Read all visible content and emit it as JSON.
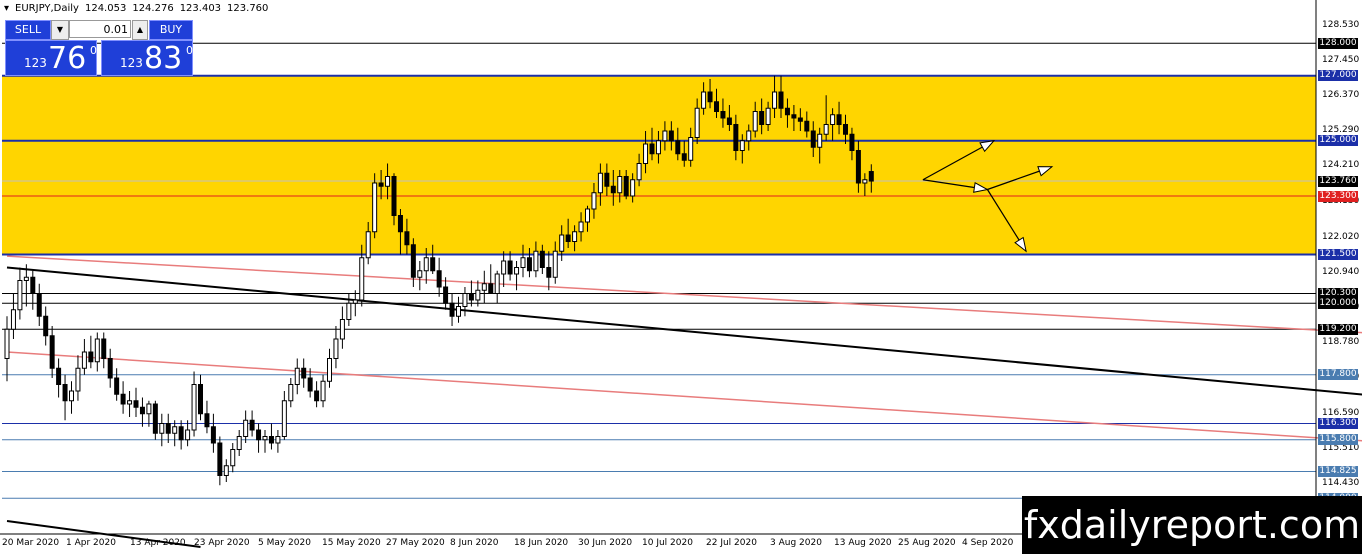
{
  "header": {
    "symbol": "EURJPY,Daily",
    "open": "124.053",
    "high": "124.276",
    "low": "123.403",
    "close": "123.760"
  },
  "trade_panel": {
    "sell_label": "SELL",
    "buy_label": "BUY",
    "lot": "0.01",
    "sell_small": "123",
    "sell_big": "76",
    "sell_sup": "0",
    "buy_small": "123",
    "buy_big": "83",
    "buy_sup": "0"
  },
  "price_scale": [
    "128.530",
    "127.450",
    "126.370",
    "125.290",
    "124.210",
    "123.130",
    "122.020",
    "120.940",
    "119.860",
    "118.780",
    "117.700",
    "116.590",
    "115.510",
    "114.430",
    "113.350"
  ],
  "level_labels": [
    {
      "text": "128.000",
      "bg": "#000000"
    },
    {
      "text": "127.000",
      "bg": "#1b2fa8"
    },
    {
      "text": "125.000",
      "bg": "#1b2fa8"
    },
    {
      "text": "123.760",
      "bg": "#000000"
    },
    {
      "text": "123.300",
      "bg": "#e02020"
    },
    {
      "text": "121.500",
      "bg": "#1b2fa8"
    },
    {
      "text": "120.300",
      "bg": "#000000"
    },
    {
      "text": "120.000",
      "bg": "#000000"
    },
    {
      "text": "119.200",
      "bg": "#000000"
    },
    {
      "text": "117.800",
      "bg": "#4a7cb0"
    },
    {
      "text": "116.300",
      "bg": "#1b2fa8"
    },
    {
      "text": "115.800",
      "bg": "#4a7cb0"
    },
    {
      "text": "114.825",
      "bg": "#4a7cb0"
    },
    {
      "text": "114.000",
      "bg": "#4a7cb0"
    }
  ],
  "dates": [
    "20 Mar 2020",
    "1 Apr 2020",
    "13 Apr 2020",
    "23 Apr 2020",
    "5 May 2020",
    "15 May 2020",
    "27 May 2020",
    "8 Jun 2020",
    "18 Jun 2020",
    "30 Jun 2020",
    "10 Jul 2020",
    "22 Jul 2020",
    "3 Aug 2020",
    "13 Aug 2020",
    "25 Aug 2020",
    "4 Sep 2020"
  ],
  "watermark": "fxdailyreport.com",
  "colors": {
    "zone": "#ffd500",
    "bull": "#ffffff",
    "bear": "#000000",
    "blue_line": "#1b2fa8",
    "red_line": "#e02020",
    "trend_red": "#e87c7c"
  },
  "chart_data": {
    "type": "candlestick",
    "symbol": "EURJPY",
    "timeframe": "Daily",
    "y_range": [
      112.9,
      128.9
    ],
    "zone": [
      121.5,
      127.0
    ],
    "horizontal_levels": [
      128.0,
      127.0,
      125.0,
      123.76,
      123.3,
      121.5,
      120.3,
      120.0,
      119.2,
      117.8,
      116.3,
      115.8,
      114.825,
      114.0
    ],
    "candles": [
      {
        "o": 118.3,
        "h": 119.6,
        "l": 117.6,
        "c": 119.2
      },
      {
        "o": 119.2,
        "h": 120.3,
        "l": 118.9,
        "c": 119.8
      },
      {
        "o": 119.8,
        "h": 121.1,
        "l": 119.5,
        "c": 120.7
      },
      {
        "o": 120.7,
        "h": 121.2,
        "l": 119.9,
        "c": 120.8
      },
      {
        "o": 120.8,
        "h": 121.0,
        "l": 119.8,
        "c": 120.3
      },
      {
        "o": 120.3,
        "h": 120.6,
        "l": 119.3,
        "c": 119.6
      },
      {
        "o": 119.6,
        "h": 119.9,
        "l": 118.7,
        "c": 119.0
      },
      {
        "o": 119.0,
        "h": 119.3,
        "l": 117.7,
        "c": 118.0
      },
      {
        "o": 118.0,
        "h": 118.3,
        "l": 117.1,
        "c": 117.5
      },
      {
        "o": 117.5,
        "h": 117.8,
        "l": 116.4,
        "c": 117.0
      },
      {
        "o": 117.0,
        "h": 117.6,
        "l": 116.6,
        "c": 117.3
      },
      {
        "o": 117.3,
        "h": 118.4,
        "l": 117.0,
        "c": 118.0
      },
      {
        "o": 118.0,
        "h": 118.9,
        "l": 117.8,
        "c": 118.5
      },
      {
        "o": 118.5,
        "h": 119.0,
        "l": 118.0,
        "c": 118.2
      },
      {
        "o": 118.2,
        "h": 119.1,
        "l": 117.9,
        "c": 118.9
      },
      {
        "o": 118.9,
        "h": 119.1,
        "l": 118.0,
        "c": 118.3
      },
      {
        "o": 118.3,
        "h": 118.6,
        "l": 117.4,
        "c": 117.7
      },
      {
        "o": 117.7,
        "h": 118.0,
        "l": 117.0,
        "c": 117.2
      },
      {
        "o": 117.2,
        "h": 117.6,
        "l": 116.6,
        "c": 116.9
      },
      {
        "o": 116.9,
        "h": 117.3,
        "l": 116.5,
        "c": 117.0
      },
      {
        "o": 117.0,
        "h": 117.4,
        "l": 116.5,
        "c": 116.8
      },
      {
        "o": 116.8,
        "h": 117.1,
        "l": 116.2,
        "c": 116.6
      },
      {
        "o": 116.6,
        "h": 117.0,
        "l": 116.2,
        "c": 116.9
      },
      {
        "o": 116.9,
        "h": 117.0,
        "l": 115.8,
        "c": 116.0
      },
      {
        "o": 116.0,
        "h": 116.6,
        "l": 115.6,
        "c": 116.3
      },
      {
        "o": 116.3,
        "h": 116.6,
        "l": 115.7,
        "c": 116.0
      },
      {
        "o": 116.0,
        "h": 116.4,
        "l": 115.6,
        "c": 116.2
      },
      {
        "o": 116.2,
        "h": 116.4,
        "l": 115.5,
        "c": 115.8
      },
      {
        "o": 115.8,
        "h": 116.4,
        "l": 115.6,
        "c": 116.1
      },
      {
        "o": 116.1,
        "h": 117.9,
        "l": 115.9,
        "c": 117.5
      },
      {
        "o": 117.5,
        "h": 117.8,
        "l": 116.4,
        "c": 116.6
      },
      {
        "o": 116.6,
        "h": 117.0,
        "l": 116.0,
        "c": 116.2
      },
      {
        "o": 116.2,
        "h": 116.6,
        "l": 115.4,
        "c": 115.7
      },
      {
        "o": 115.7,
        "h": 115.9,
        "l": 114.4,
        "c": 114.7
      },
      {
        "o": 114.7,
        "h": 115.2,
        "l": 114.5,
        "c": 115.0
      },
      {
        "o": 115.0,
        "h": 115.7,
        "l": 114.8,
        "c": 115.5
      },
      {
        "o": 115.5,
        "h": 116.1,
        "l": 115.3,
        "c": 115.9
      },
      {
        "o": 115.9,
        "h": 116.7,
        "l": 115.7,
        "c": 116.4
      },
      {
        "o": 116.4,
        "h": 116.7,
        "l": 115.9,
        "c": 116.1
      },
      {
        "o": 116.1,
        "h": 116.3,
        "l": 115.4,
        "c": 115.8
      },
      {
        "o": 115.8,
        "h": 116.1,
        "l": 115.4,
        "c": 115.9
      },
      {
        "o": 115.9,
        "h": 116.3,
        "l": 115.5,
        "c": 115.7
      },
      {
        "o": 115.7,
        "h": 116.1,
        "l": 115.4,
        "c": 115.9
      },
      {
        "o": 115.9,
        "h": 117.3,
        "l": 115.8,
        "c": 117.0
      },
      {
        "o": 117.0,
        "h": 117.7,
        "l": 116.8,
        "c": 117.5
      },
      {
        "o": 117.5,
        "h": 118.3,
        "l": 117.2,
        "c": 118.0
      },
      {
        "o": 118.0,
        "h": 118.3,
        "l": 117.4,
        "c": 117.7
      },
      {
        "o": 117.7,
        "h": 118.0,
        "l": 117.1,
        "c": 117.3
      },
      {
        "o": 117.3,
        "h": 117.6,
        "l": 116.8,
        "c": 117.0
      },
      {
        "o": 117.0,
        "h": 117.8,
        "l": 116.8,
        "c": 117.6
      },
      {
        "o": 117.6,
        "h": 118.6,
        "l": 117.4,
        "c": 118.3
      },
      {
        "o": 118.3,
        "h": 119.3,
        "l": 118.0,
        "c": 118.9
      },
      {
        "o": 118.9,
        "h": 119.9,
        "l": 118.6,
        "c": 119.5
      },
      {
        "o": 119.5,
        "h": 120.3,
        "l": 119.3,
        "c": 120.0
      },
      {
        "o": 120.0,
        "h": 120.4,
        "l": 119.6,
        "c": 120.1
      },
      {
        "o": 120.1,
        "h": 121.8,
        "l": 119.9,
        "c": 121.4
      },
      {
        "o": 121.4,
        "h": 122.5,
        "l": 121.2,
        "c": 122.2
      },
      {
        "o": 122.2,
        "h": 124.0,
        "l": 122.0,
        "c": 123.7
      },
      {
        "o": 123.7,
        "h": 124.1,
        "l": 123.2,
        "c": 123.6
      },
      {
        "o": 123.6,
        "h": 124.3,
        "l": 123.2,
        "c": 123.9
      },
      {
        "o": 123.9,
        "h": 124.0,
        "l": 122.4,
        "c": 122.7
      },
      {
        "o": 122.7,
        "h": 122.9,
        "l": 121.5,
        "c": 122.2
      },
      {
        "o": 122.2,
        "h": 122.6,
        "l": 121.5,
        "c": 121.8
      },
      {
        "o": 121.8,
        "h": 122.0,
        "l": 120.5,
        "c": 120.8
      },
      {
        "o": 120.8,
        "h": 121.3,
        "l": 120.4,
        "c": 121.0
      },
      {
        "o": 121.0,
        "h": 121.7,
        "l": 120.6,
        "c": 121.4
      },
      {
        "o": 121.4,
        "h": 121.8,
        "l": 120.9,
        "c": 121.0
      },
      {
        "o": 121.0,
        "h": 121.4,
        "l": 120.2,
        "c": 120.5
      },
      {
        "o": 120.5,
        "h": 120.8,
        "l": 119.8,
        "c": 120.0
      },
      {
        "o": 120.0,
        "h": 120.3,
        "l": 119.3,
        "c": 119.6
      },
      {
        "o": 119.6,
        "h": 120.2,
        "l": 119.4,
        "c": 119.9
      },
      {
        "o": 119.9,
        "h": 120.5,
        "l": 119.6,
        "c": 120.3
      },
      {
        "o": 120.3,
        "h": 120.7,
        "l": 119.9,
        "c": 120.1
      },
      {
        "o": 120.1,
        "h": 120.7,
        "l": 119.9,
        "c": 120.4
      },
      {
        "o": 120.4,
        "h": 121.0,
        "l": 120.0,
        "c": 120.6
      },
      {
        "o": 120.6,
        "h": 121.2,
        "l": 120.3,
        "c": 120.3
      },
      {
        "o": 120.3,
        "h": 121.0,
        "l": 120.0,
        "c": 120.9
      },
      {
        "o": 120.9,
        "h": 121.6,
        "l": 120.5,
        "c": 121.3
      },
      {
        "o": 121.3,
        "h": 121.6,
        "l": 120.7,
        "c": 120.9
      },
      {
        "o": 120.9,
        "h": 121.3,
        "l": 120.4,
        "c": 121.1
      },
      {
        "o": 121.1,
        "h": 121.8,
        "l": 120.8,
        "c": 121.4
      },
      {
        "o": 121.4,
        "h": 121.7,
        "l": 120.8,
        "c": 121.0
      },
      {
        "o": 121.0,
        "h": 121.9,
        "l": 120.8,
        "c": 121.6
      },
      {
        "o": 121.6,
        "h": 121.8,
        "l": 120.9,
        "c": 121.1
      },
      {
        "o": 121.1,
        "h": 121.6,
        "l": 120.4,
        "c": 120.8
      },
      {
        "o": 120.8,
        "h": 121.9,
        "l": 120.6,
        "c": 121.6
      },
      {
        "o": 121.6,
        "h": 122.4,
        "l": 121.3,
        "c": 122.1
      },
      {
        "o": 122.1,
        "h": 122.6,
        "l": 121.7,
        "c": 121.9
      },
      {
        "o": 121.9,
        "h": 122.4,
        "l": 121.6,
        "c": 122.2
      },
      {
        "o": 122.2,
        "h": 122.8,
        "l": 121.9,
        "c": 122.5
      },
      {
        "o": 122.5,
        "h": 123.0,
        "l": 122.2,
        "c": 122.9
      },
      {
        "o": 122.9,
        "h": 123.7,
        "l": 122.6,
        "c": 123.4
      },
      {
        "o": 123.4,
        "h": 124.3,
        "l": 123.0,
        "c": 124.0
      },
      {
        "o": 124.0,
        "h": 124.3,
        "l": 123.3,
        "c": 123.6
      },
      {
        "o": 123.6,
        "h": 124.1,
        "l": 123.0,
        "c": 123.4
      },
      {
        "o": 123.4,
        "h": 124.1,
        "l": 123.1,
        "c": 123.9
      },
      {
        "o": 123.9,
        "h": 124.1,
        "l": 123.2,
        "c": 123.3
      },
      {
        "o": 123.3,
        "h": 124.0,
        "l": 123.1,
        "c": 123.8
      },
      {
        "o": 123.8,
        "h": 124.6,
        "l": 123.6,
        "c": 124.3
      },
      {
        "o": 124.3,
        "h": 125.3,
        "l": 124.0,
        "c": 124.9
      },
      {
        "o": 124.9,
        "h": 125.4,
        "l": 124.4,
        "c": 124.6
      },
      {
        "o": 124.6,
        "h": 125.3,
        "l": 124.3,
        "c": 125.0
      },
      {
        "o": 125.0,
        "h": 125.6,
        "l": 124.7,
        "c": 125.3
      },
      {
        "o": 125.3,
        "h": 125.6,
        "l": 124.7,
        "c": 125.0
      },
      {
        "o": 125.0,
        "h": 125.4,
        "l": 124.4,
        "c": 124.6
      },
      {
        "o": 124.6,
        "h": 125.0,
        "l": 124.2,
        "c": 124.4
      },
      {
        "o": 124.4,
        "h": 125.4,
        "l": 124.2,
        "c": 125.1
      },
      {
        "o": 125.1,
        "h": 126.3,
        "l": 124.9,
        "c": 126.0
      },
      {
        "o": 126.0,
        "h": 126.8,
        "l": 125.8,
        "c": 126.5
      },
      {
        "o": 126.5,
        "h": 126.9,
        "l": 126.0,
        "c": 126.2
      },
      {
        "o": 126.2,
        "h": 126.6,
        "l": 125.7,
        "c": 125.9
      },
      {
        "o": 125.9,
        "h": 126.3,
        "l": 125.4,
        "c": 125.7
      },
      {
        "o": 125.7,
        "h": 126.1,
        "l": 125.3,
        "c": 125.5
      },
      {
        "o": 125.5,
        "h": 125.8,
        "l": 124.4,
        "c": 124.7
      },
      {
        "o": 124.7,
        "h": 125.2,
        "l": 124.3,
        "c": 125.0
      },
      {
        "o": 125.0,
        "h": 125.5,
        "l": 124.7,
        "c": 125.3
      },
      {
        "o": 125.3,
        "h": 126.2,
        "l": 125.1,
        "c": 125.9
      },
      {
        "o": 125.9,
        "h": 126.3,
        "l": 125.2,
        "c": 125.5
      },
      {
        "o": 125.5,
        "h": 126.2,
        "l": 125.3,
        "c": 126.0
      },
      {
        "o": 126.0,
        "h": 127.0,
        "l": 125.7,
        "c": 126.5
      },
      {
        "o": 126.5,
        "h": 127.0,
        "l": 125.7,
        "c": 126.0
      },
      {
        "o": 126.0,
        "h": 126.3,
        "l": 125.4,
        "c": 125.8
      },
      {
        "o": 125.8,
        "h": 126.1,
        "l": 125.3,
        "c": 125.7
      },
      {
        "o": 125.7,
        "h": 126.0,
        "l": 125.3,
        "c": 125.6
      },
      {
        "o": 125.6,
        "h": 125.9,
        "l": 125.1,
        "c": 125.3
      },
      {
        "o": 125.3,
        "h": 125.6,
        "l": 124.5,
        "c": 124.8
      },
      {
        "o": 124.8,
        "h": 125.4,
        "l": 124.3,
        "c": 125.2
      },
      {
        "o": 125.2,
        "h": 126.4,
        "l": 125.0,
        "c": 125.5
      },
      {
        "o": 125.5,
        "h": 126.0,
        "l": 125.0,
        "c": 125.8
      },
      {
        "o": 125.8,
        "h": 126.2,
        "l": 125.2,
        "c": 125.5
      },
      {
        "o": 125.5,
        "h": 125.8,
        "l": 124.9,
        "c": 125.2
      },
      {
        "o": 125.2,
        "h": 125.4,
        "l": 124.4,
        "c": 124.7
      },
      {
        "o": 124.7,
        "h": 125.0,
        "l": 123.4,
        "c": 123.7
      },
      {
        "o": 123.7,
        "h": 124.0,
        "l": 123.3,
        "c": 123.8
      },
      {
        "o": 124.053,
        "h": 124.276,
        "l": 123.403,
        "c": 123.76
      }
    ],
    "trendlines": [
      {
        "color": "black",
        "p1": {
          "i": 0,
          "price": 121.1
        },
        "p2": {
          "i": 250,
          "price": 116.45
        }
      },
      {
        "color": "red",
        "p1": {
          "i": 0,
          "price": 121.45
        },
        "p2": {
          "i": 250,
          "price": 118.65
        }
      },
      {
        "color": "red",
        "p1": {
          "i": 0,
          "price": 118.5
        },
        "p2": {
          "i": 250,
          "price": 115.25
        }
      },
      {
        "color": "black",
        "p1": {
          "i": 0,
          "price": 113.3
        },
        "p2": {
          "i": 30,
          "price": 112.5
        }
      }
    ],
    "projection_arrows": [
      {
        "from": {
          "i": 142,
          "price": 123.8
        },
        "to": {
          "i": 153,
          "price": 125.0
        }
      },
      {
        "from": {
          "i": 142,
          "price": 123.8
        },
        "to": {
          "i": 152,
          "price": 123.5
        }
      },
      {
        "from": {
          "i": 152,
          "price": 123.5
        },
        "to": {
          "i": 162,
          "price": 124.2
        }
      },
      {
        "from": {
          "i": 152,
          "price": 123.5
        },
        "to": {
          "i": 158,
          "price": 121.6
        }
      }
    ]
  }
}
